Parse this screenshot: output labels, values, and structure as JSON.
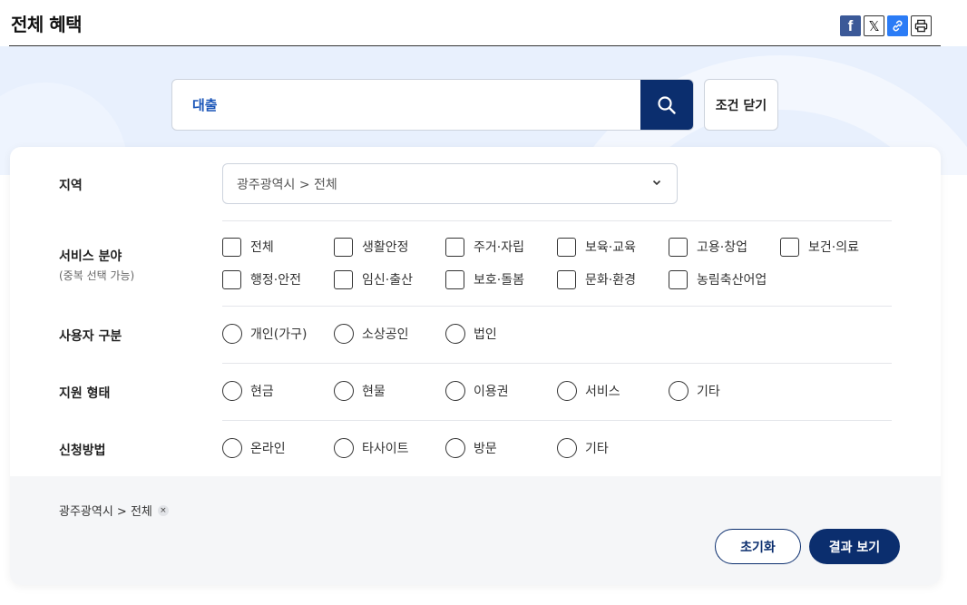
{
  "header": {
    "title": "전체 혜택",
    "share": {
      "facebook_glyph": "f",
      "x_glyph": "𝕏"
    }
  },
  "search": {
    "value": "대출",
    "close_label": "조건 닫기"
  },
  "filters": {
    "region": {
      "label": "지역",
      "selected": "광주광역시 > 전체"
    },
    "service": {
      "label": "서비스 분야",
      "sub": "(중복 선택 가능)",
      "options": [
        "전체",
        "생활안정",
        "주거·자립",
        "보육·교육",
        "고용·창업",
        "보건·의료",
        "행정·안전",
        "임신·출산",
        "보호·돌봄",
        "문화·환경",
        "농림축산어업"
      ]
    },
    "user_type": {
      "label": "사용자 구분",
      "options": [
        "개인(가구)",
        "소상공인",
        "법인"
      ]
    },
    "support_type": {
      "label": "지원 형태",
      "options": [
        "현금",
        "현물",
        "이용권",
        "서비스",
        "기타"
      ]
    },
    "apply_method": {
      "label": "신청방법",
      "options": [
        "온라인",
        "타사이트",
        "방문",
        "기타"
      ]
    }
  },
  "footer": {
    "chip": "광주광역시 > 전체",
    "chip_close": "×",
    "reset_label": "초기화",
    "result_label": "결과 보기"
  },
  "colors": {
    "primary": "#0b2e6e",
    "hero_bg": "#e8f0fd",
    "search_text": "#1a55b8"
  }
}
